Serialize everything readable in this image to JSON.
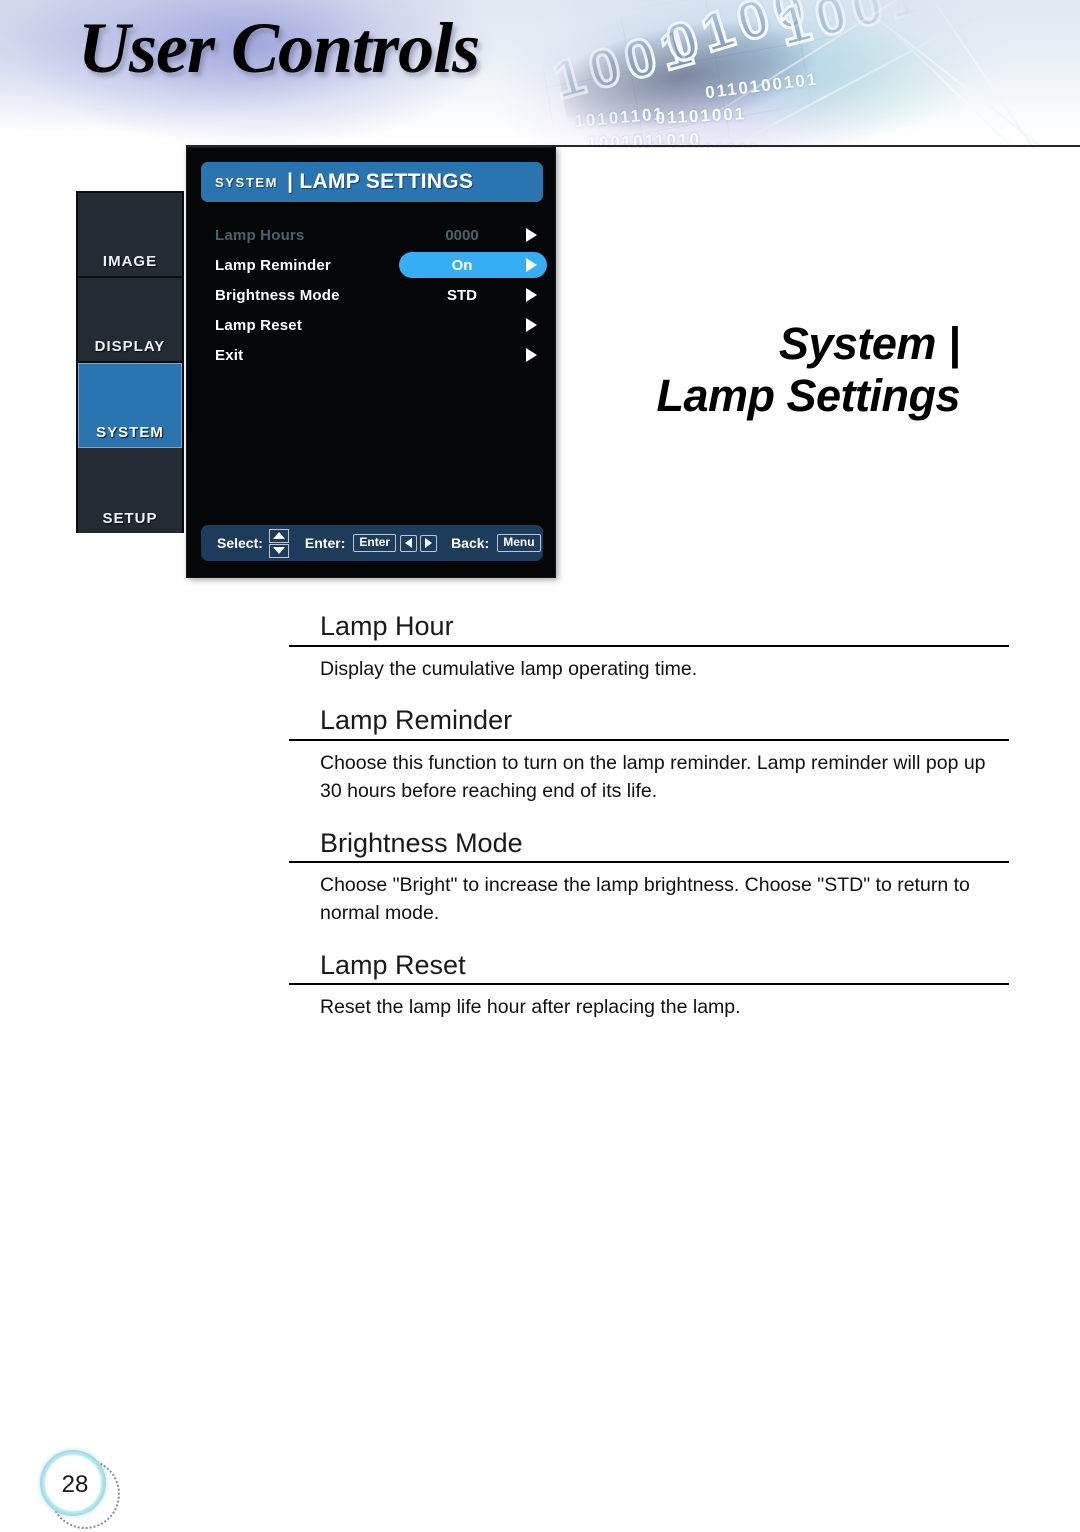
{
  "header": {
    "title": "User Controls",
    "binary_rows_large": [
      "1001",
      "0100",
      "1001"
    ],
    "binary_rows_small": [
      "10101101",
      "01101001",
      "1001011010",
      "0110100101",
      "101101001011"
    ]
  },
  "osd": {
    "sidebar": {
      "items": [
        {
          "label": "IMAGE",
          "active": false
        },
        {
          "label": "DISPLAY",
          "active": false
        },
        {
          "label": "SYSTEM",
          "active": true
        },
        {
          "label": "SETUP",
          "active": false
        }
      ]
    },
    "titlebar": {
      "category": "SYSTEM",
      "separator": "|",
      "page": "LAMP SETTINGS"
    },
    "rows": [
      {
        "label": "Lamp Hours",
        "value": "0000",
        "state": "dim"
      },
      {
        "label": "Lamp Reminder",
        "value": "On",
        "state": "selected"
      },
      {
        "label": "Brightness Mode",
        "value": "STD",
        "state": "normal"
      },
      {
        "label": "Lamp Reset",
        "value": "",
        "state": "normal"
      },
      {
        "label": "Exit",
        "value": "",
        "state": "normal"
      }
    ],
    "footer": {
      "select_label": "Select:",
      "enter_label": "Enter:",
      "enter_key": "Enter",
      "back_label": "Back:",
      "back_key": "Menu"
    },
    "colors": {
      "titlebar_blue": "#2a75b0",
      "highlight_blue": "#35aef5",
      "footer_blue": "#1d3c5c",
      "panel_black": "#050608",
      "tab_grey": "#242b33",
      "dim_text": "#4a626e"
    }
  },
  "section_heading": {
    "line1": "System |",
    "line2": "Lamp Settings"
  },
  "content": {
    "sections": [
      {
        "title": "Lamp Hour",
        "body": "Display the cumulative lamp operating time."
      },
      {
        "title": "Lamp Reminder",
        "body": "Choose this function to turn on the lamp reminder. Lamp reminder will pop up 30 hours before reaching end of its life."
      },
      {
        "title": "Brightness Mode",
        "body": "Choose \"Bright\" to increase the lamp brightness. Choose \"STD\" to return to normal mode."
      },
      {
        "title": "Lamp Reset",
        "body": "Reset the lamp life hour after replacing the lamp."
      }
    ]
  },
  "footer": {
    "page_number": "28"
  }
}
